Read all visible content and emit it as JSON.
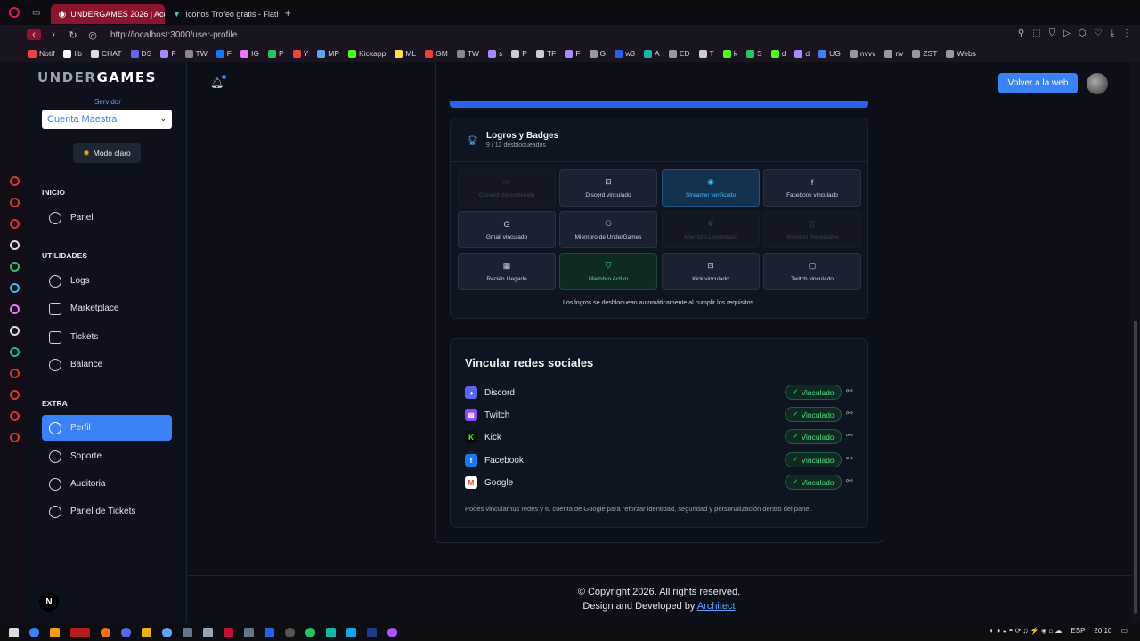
{
  "browser": {
    "tabs": [
      {
        "label": "UNDERGAMES 2026 | Acc",
        "active": true
      },
      {
        "label": "Iconos Trofeo gratis - Flati",
        "active": false
      }
    ],
    "url": "http://localhost:3000/user-profile",
    "bookmarks": [
      "Notif",
      "lib",
      "CHAT",
      "DS",
      "F",
      "TW",
      "F",
      "IG",
      "P",
      "Y",
      "MP",
      "Kickapp",
      "ML",
      "GM",
      "TW",
      "s",
      "P",
      "TF",
      "F",
      "G",
      "w3",
      "A",
      "ED",
      "T",
      "k",
      "S",
      "d",
      "d",
      "UG",
      "nvvv",
      "nv",
      "ZST",
      "Webs"
    ]
  },
  "sidebar": {
    "logo_a": "UNDER",
    "logo_b": "GAMES",
    "server_label": "Servidor",
    "server_value": "Cuenta Maestra",
    "mode_button": "Modo claro",
    "sections": {
      "inicio": "INICIO",
      "utilidades": "UTILIDADES",
      "extra": "EXTRA"
    },
    "items": {
      "panel": "Panel",
      "logs": "Logs",
      "marketplace": "Marketplace",
      "tickets": "Tickets",
      "balance": "Balance",
      "perfil": "Perfil",
      "soporte": "Soporte",
      "auditoria": "Auditoria",
      "panel_tickets": "Panel de Tickets"
    },
    "badge_letter": "N"
  },
  "header": {
    "back_button": "Volver a la web"
  },
  "achievements": {
    "title": "Logros y Badges",
    "subtitle": "9 / 12 desbloqueados",
    "badges": [
      {
        "label": "Creador de contenido",
        "state": "locked"
      },
      {
        "label": "Discord vinculado",
        "state": "unlocked"
      },
      {
        "label": "Streamer verificado",
        "state": "highlight-blue"
      },
      {
        "label": "Facebook vinculado",
        "state": "unlocked"
      },
      {
        "label": "Gmail vinculado",
        "state": "unlocked"
      },
      {
        "label": "Miembro de UnderGames",
        "state": "unlocked"
      },
      {
        "label": "Miembro Legendario",
        "state": "locked"
      },
      {
        "label": "Miembro Respetable",
        "state": "locked"
      },
      {
        "label": "Recién Llegado",
        "state": "unlocked"
      },
      {
        "label": "Miembro Activo",
        "state": "highlight-green"
      },
      {
        "label": "Kick vinculado",
        "state": "unlocked"
      },
      {
        "label": "Twitch vinculado",
        "state": "unlocked"
      }
    ],
    "note": "Los logros se desbloquean automáticamente al cumplir los requisitos."
  },
  "social": {
    "title": "Vincular redes sociales",
    "linked_label": "Vinculado",
    "rows": [
      {
        "name": "Discord",
        "color": "#5865f2"
      },
      {
        "name": "Twitch",
        "color": "#9146ff"
      },
      {
        "name": "Kick",
        "color": "#0a0a0a"
      },
      {
        "name": "Facebook",
        "color": "#1877f2"
      },
      {
        "name": "Google",
        "color": "#ffffff"
      }
    ],
    "note": "Podés vincular tus redes y tu cuenta de Google para reforzar identidad, seguridad y personalización dentro del panel."
  },
  "footer": {
    "copyright": "© Copyright 2026. All rights reserved.",
    "credit_prefix": "Design and Developed by",
    "credit_link": "Architect"
  },
  "taskbar": {
    "lang": "ESP",
    "time": "20:10"
  }
}
